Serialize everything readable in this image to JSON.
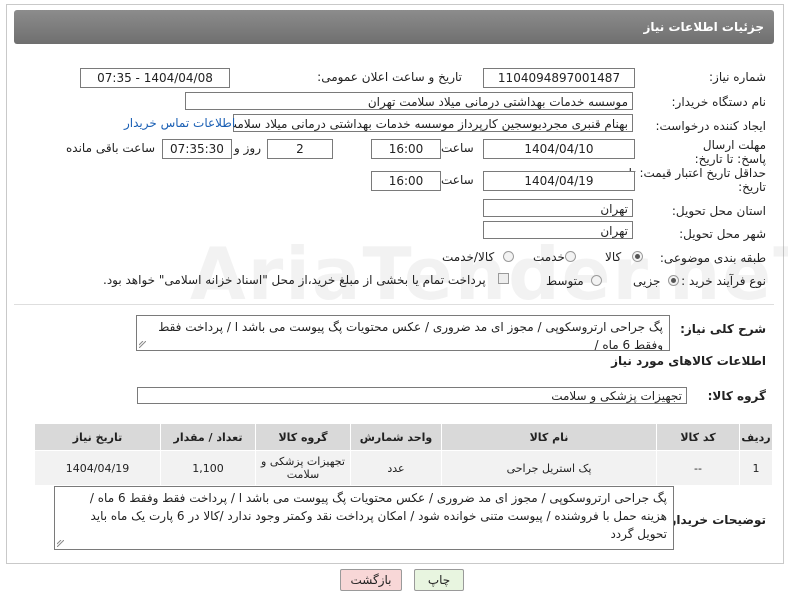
{
  "header": {
    "title": "جزئیات اطلاعات نیاز"
  },
  "fields": {
    "need_number_label": "شماره نیاز:",
    "need_number": "1104094897001487",
    "announce_label": "تاریخ و ساعت اعلان عمومی:",
    "announce_value": "1404/04/08 - 07:35",
    "buyer_org_label": "نام دستگاه خریدار:",
    "buyer_org": "موسسه خدمات بهداشتی درمانی میلاد سلامت تهران",
    "creator_label": "ایجاد کننده درخواست:",
    "creator": "بهنام قنبری مجردبوسجین کارپرداز موسسه خدمات بهداشتی درمانی میلاد سلامت تهران",
    "buyer_contact_link": "اطلاعات تماس خریدار",
    "deadline_label": "مهلت ارسال پاسخ: تا تاریخ:",
    "deadline_date": "1404/04/10",
    "time_label": "ساعت",
    "deadline_time": "16:00",
    "deadline_days": "2",
    "days_label": "روز و",
    "remaining_time": "07:35:30",
    "remaining_label": "ساعت باقی مانده",
    "validity_label": "حداقل تاریخ اعتبار قیمت: تا تاریخ:",
    "validity_date": "1404/04/19",
    "validity_time": "16:00",
    "province_label": "استان محل تحویل:",
    "province": "تهران",
    "city_label": "شهر محل تحویل:",
    "city": "تهران",
    "category_label": "طبقه بندی موضوعی:",
    "category_options": [
      "کالا",
      "خدمت",
      "کالا/خدمت"
    ],
    "category_selected": "کالا",
    "process_label": "نوع فرآیند خرید :",
    "process_options": [
      "جزیی",
      "متوسط"
    ],
    "process_selected": "جزیی",
    "treasury_note": "پرداخت تمام یا بخشی از مبلغ خرید،از محل \"اسناد خزانه اسلامی\" خواهد بود."
  },
  "description": {
    "label": "شرح کلی نیاز:",
    "text": "پگ جراحی ارتروسکوپی / مجوز ای مد ضروری / عکس محتویات پگ پیوست می باشد ا  / پرداخت فقط وفقط 6 ماه /"
  },
  "goods_info": {
    "section_title": "اطلاعات کالاهای مورد نیاز",
    "group_label": "گروه کالا:",
    "group_value": "تجهیزات پزشکی و سلامت"
  },
  "table": {
    "headers": [
      "ردیف",
      "کد کالا",
      "نام کالا",
      "واحد شمارش",
      "گروه کالا",
      "تعداد / مقدار",
      "تاریخ نیاز"
    ],
    "rows": [
      [
        "1",
        "--",
        "پک استریل جراحی",
        "عدد",
        "تجهیزات پزشکی و سلامت",
        "1,100",
        "1404/04/19"
      ]
    ]
  },
  "buyer_notes": {
    "label": "توضیحات خریدار:",
    "text": "پگ جراحی ارتروسکوپی / مجوز ای مد ضروری / عکس محتویات پگ پیوست می باشد ا  / پرداخت فقط وفقط 6  ماه / هزینه حمل با فروشنده / پیوست  متنی خوانده شود / امکان پرداخت نقد وکمتر وجود ندارد /کالا در 6 پارت یک ماه باید تحویل گردد"
  },
  "buttons": {
    "print": "چاپ",
    "back": "بازگشت"
  },
  "watermark": "AriaTender.neT",
  "colors": {
    "title_bar": "#7d7d7d",
    "link": "#1a5fb4",
    "back_button": "#f8d7d7",
    "print_button": "#e8f5e0"
  }
}
